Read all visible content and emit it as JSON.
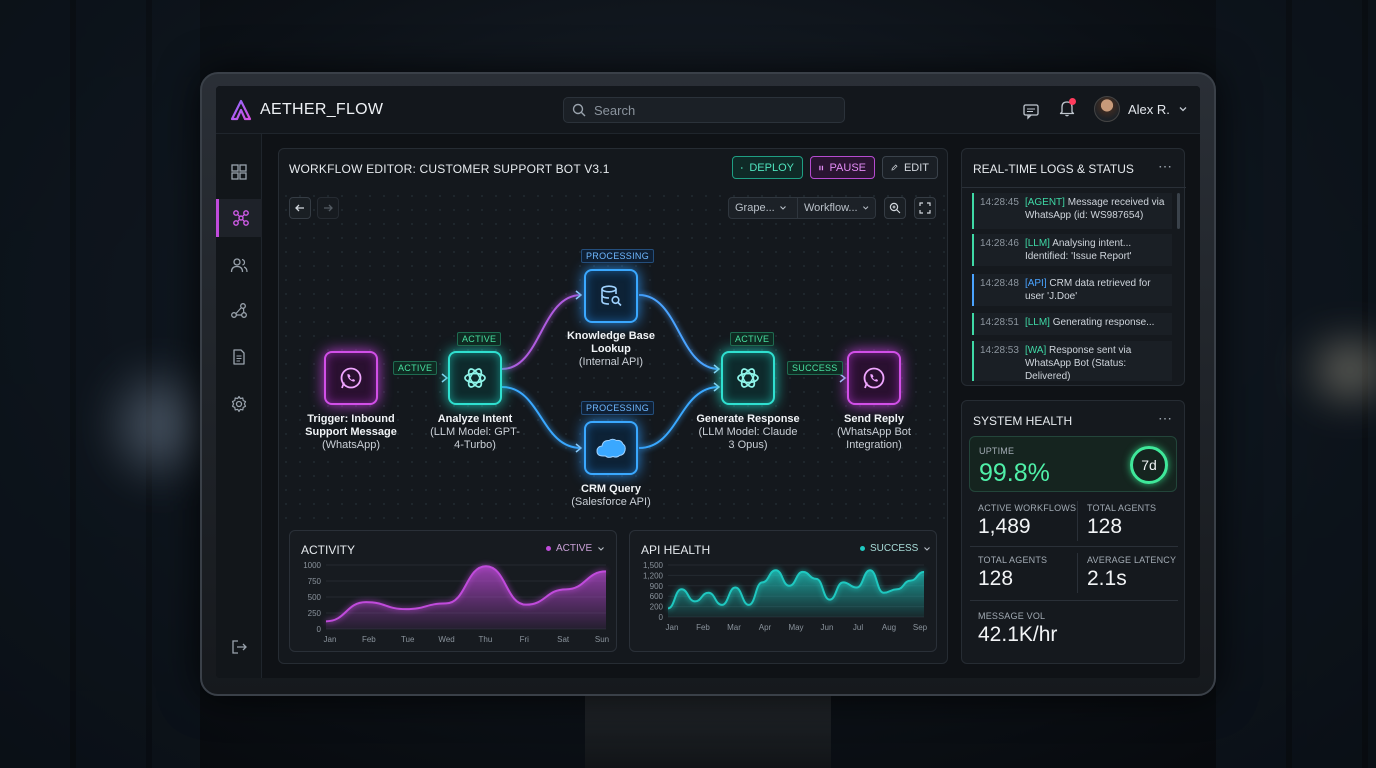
{
  "app": {
    "name": "AETHER_FLOW"
  },
  "search": {
    "placeholder": "Search"
  },
  "user": {
    "name": "Alex R."
  },
  "sidebar": {
    "items": [
      "dashboard-icon",
      "workflows-icon",
      "agents-icon",
      "integrations-icon",
      "documents-icon",
      "settings-icon",
      "logout-icon"
    ]
  },
  "editor": {
    "title": "WORKFLOW EDITOR: CUSTOMER SUPPORT BOT V3.1",
    "deploy_label": "DEPLOY",
    "pause_label": "PAUSE",
    "edit_label": "EDIT",
    "select1": "Grape...",
    "select2": "Workflow...",
    "nodes": [
      {
        "title": "Trigger: Inbound Support Message",
        "sub": "(WhatsApp)"
      },
      {
        "tag": "ACTIVE",
        "title": "Analyze Intent",
        "sub": "(LLM Model: GPT-4-Turbo)"
      },
      {
        "tag": "PROCESSING",
        "title": "Knowledge Base Lookup",
        "sub": "(Internal API)"
      },
      {
        "tag": "PROCESSING",
        "title": "CRM Query",
        "sub": "(Salesforce API)"
      },
      {
        "tag": "ACTIVE",
        "title": "Generate Response",
        "sub": "(LLM Model: Claude 3 Opus)"
      },
      {
        "title": "Send Reply",
        "sub": "(WhatsApp Bot Integration)"
      }
    ],
    "edge_tags": {
      "trigger_to_intent": "ACTIVE",
      "response_to_reply": "SUCCESS"
    }
  },
  "activity": {
    "title": "ACTIVITY",
    "legend": "ACTIVE"
  },
  "api_health": {
    "title": "API HEALTH",
    "legend": "SUCCESS"
  },
  "chart_data": [
    {
      "type": "area",
      "title": "ACTIVITY",
      "series": [
        {
          "name": "ACTIVE",
          "values": [
            120,
            420,
            310,
            400,
            980,
            380,
            620,
            900
          ]
        }
      ],
      "x": [
        "Jan",
        "Feb",
        "Tue",
        "Wed",
        "Thu",
        "Fri",
        "Sat",
        "Sun"
      ],
      "xticks": [
        "Jan",
        "Feb",
        "Tue",
        "Wed",
        "Thu",
        "Fri",
        "Sat",
        "Sun"
      ],
      "yticks": [
        "1000",
        "750",
        "500",
        "250",
        "0"
      ],
      "ylim": [
        0,
        1000
      ],
      "color": "#c04bdb"
    },
    {
      "type": "area",
      "title": "API HEALTH",
      "series": [
        {
          "name": "SUCCESS",
          "values": [
            250,
            800,
            450,
            700,
            350,
            850,
            350,
            1000,
            1350,
            900,
            1300,
            1100,
            500,
            1000,
            850,
            1350,
            700,
            800,
            1050,
            1300
          ]
        }
      ],
      "xticks": [
        "Jan",
        "Feb",
        "Mar",
        "Apr",
        "May",
        "Jun",
        "Jul",
        "Aug",
        "Sep"
      ],
      "yticks": [
        "1,500",
        "1,200",
        "900",
        "600",
        "200",
        "0"
      ],
      "ylim": [
        0,
        1500
      ],
      "color": "#1fc8c0"
    }
  ],
  "logs": {
    "title": "REAL-TIME LOGS & STATUS",
    "entries": [
      {
        "time": "14:28:45",
        "level": "[AGENT]",
        "text": "Message received via WhatsApp (id: WS987654)",
        "color": "#3fd9a6"
      },
      {
        "time": "14:28:46",
        "level": "[LLM]",
        "text": "Analysing intent... Identified: 'Issue Report'",
        "color": "#3fd9a6"
      },
      {
        "time": "14:28:48",
        "level": "[API]",
        "text": "CRM data retrieved for user 'J.Doe'",
        "color": "#4aa3ff"
      },
      {
        "time": "14:28:51",
        "level": "[LLM]",
        "text": "Generating response...",
        "color": "#3fd9a6"
      },
      {
        "time": "14:28:53",
        "level": "[WA]",
        "text": "Response sent via WhatsApp Bot (Status: Delivered)",
        "color": "#3fd9a6"
      }
    ]
  },
  "health": {
    "title": "SYSTEM HEALTH",
    "uptime_label": "UPTIME",
    "uptime_value": "99.8%",
    "uptime_period": "7d",
    "metrics": [
      {
        "label": "ACTIVE WORKFLOWS",
        "value": "1,489"
      },
      {
        "label": "TOTAL AGENTS",
        "value": "128"
      },
      {
        "label": "TOTAL AGENTS",
        "value": "128"
      },
      {
        "label": "AVERAGE LATENCY",
        "value": "2.1s"
      },
      {
        "label": "MESSAGE VOL",
        "value": "42.1K/hr"
      }
    ]
  },
  "colors": {
    "accent_pink": "#c04bdb",
    "accent_cyan": "#1fc8c0",
    "accent_blue": "#3aa8ff",
    "success_green": "#3fd9a6"
  }
}
